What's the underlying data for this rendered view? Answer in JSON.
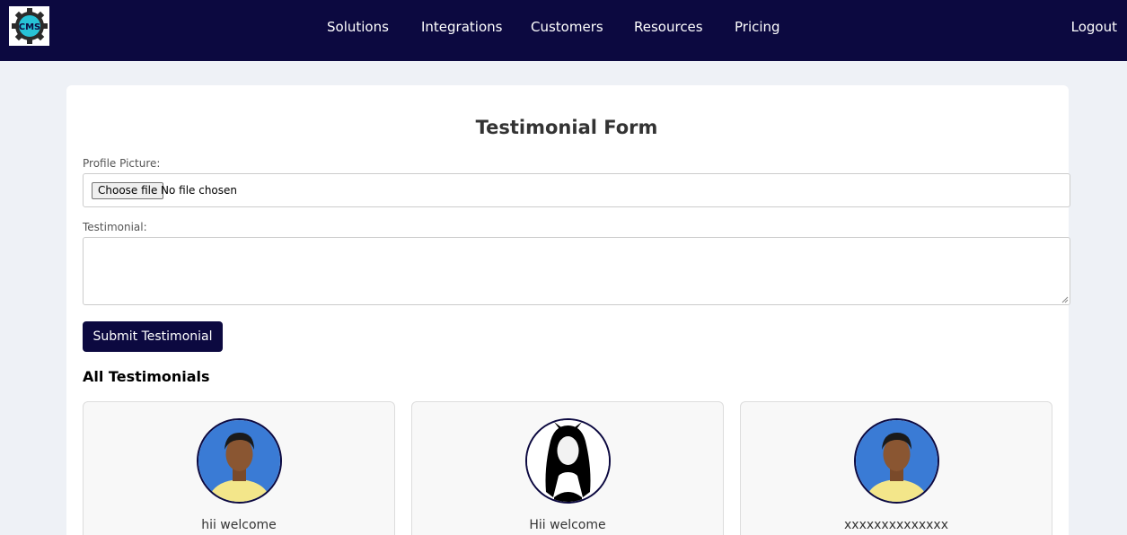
{
  "navbar": {
    "logo_text": "CMS",
    "links": [
      "Solutions",
      "Integrations",
      "Customers",
      "Resources",
      "Pricing"
    ],
    "logout_label": "Logout"
  },
  "form": {
    "title": "Testimonial Form",
    "profile_label": "Profile Picture:",
    "choose_file_label": "Choose file",
    "file_status": "No file chosen",
    "testimonial_label": "Testimonial:",
    "testimonial_value": "",
    "submit_label": "Submit Testimonial"
  },
  "testimonials": {
    "title": "All Testimonials",
    "items": [
      {
        "text": "hii welcome",
        "avatar": "photo-boy"
      },
      {
        "text": "Hii welcome",
        "avatar": "silhouette-girl"
      },
      {
        "text": "xxxxxxxxxxxxxx",
        "avatar": "photo-boy"
      }
    ]
  },
  "colors": {
    "navbar_bg": "#0c0940",
    "page_bg": "#eef1f6",
    "button_bg": "#0c0940",
    "avatar_bg_blue": "#3a7bd5"
  }
}
